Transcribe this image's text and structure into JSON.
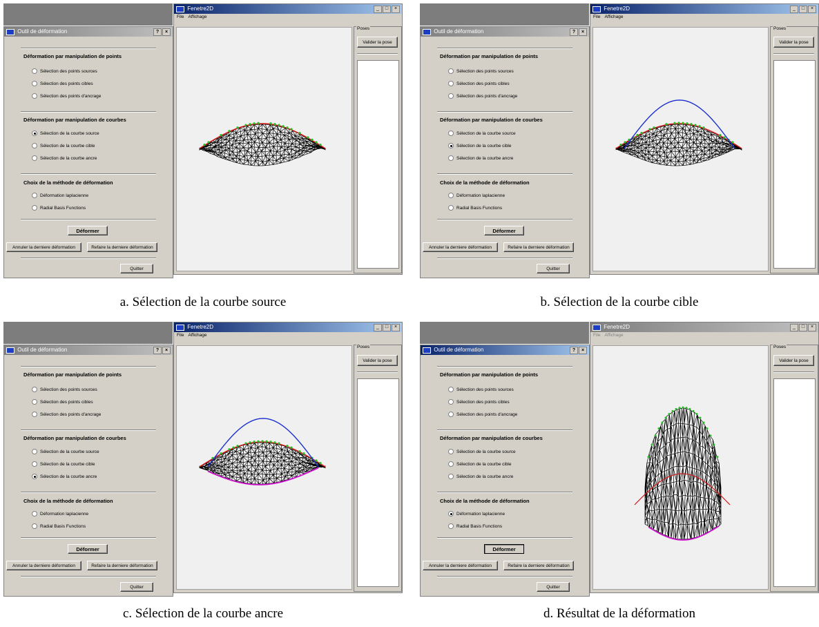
{
  "panels": [
    {
      "dialog": {
        "title": "Outil de déformation",
        "title_active": false,
        "help": "?",
        "close": "×",
        "section1": "Déformation par manipulation de points",
        "opt_points_sources": "Sélection des points sources",
        "opt_points_cibles": "Sélection des points cibles",
        "opt_points_ancrage": "Sélection des points d'ancrage",
        "section2": "Déformation par manipulation de courbes",
        "opt_courbe_source": "Sélection de la courbe source",
        "opt_courbe_cible": "Sélection de la courbe cible",
        "opt_courbe_ancre": "Sélection de la courbe ancre",
        "section3": "Choix de la méthode de déformation",
        "opt_laplacienne": "Déformation laplacienne",
        "opt_rbf": "Radial Basis Functions",
        "deformer": "Déformer",
        "annuler": "Annuler la derniere déformation",
        "refaire": "Refaire la derniere déformation",
        "quitter": "Quitter",
        "selected": "courbe_source"
      },
      "window": {
        "title": "Fenetre2D",
        "title_active": true,
        "menu_file": "File",
        "menu_affichage": "Affichage",
        "poses_label": "Poses",
        "valider": "Valider la pose"
      },
      "caption": "a. Sélection de la courbe source"
    },
    {
      "dialog": {
        "title": "Outil de déformation",
        "title_active": false,
        "help": "?",
        "close": "×",
        "section1": "Déformation par manipulation de points",
        "opt_points_sources": "Sélection des points sources",
        "opt_points_cibles": "Sélection des points cibles",
        "opt_points_ancrage": "Sélection des points d'ancrage",
        "section2": "Déformation par manipulation de courbes",
        "opt_courbe_source": "Sélection de la courbe source",
        "opt_courbe_cible": "Sélection de la courbe cible",
        "opt_courbe_ancre": "Sélection de la courbe ancre",
        "section3": "Choix de la méthode de déformation",
        "opt_laplacienne": "Déformation laplacienne",
        "opt_rbf": "Radial Basis Functions",
        "deformer": "Déformer",
        "annuler": "Annuler la derniere déformation",
        "refaire": "Refaire la derniere déformation",
        "quitter": "Quitter",
        "selected": "courbe_cible"
      },
      "window": {
        "title": "Fenetre2D",
        "title_active": true,
        "menu_file": "File",
        "menu_affichage": "Affichage",
        "poses_label": "Poses",
        "valider": "Valider la pose"
      },
      "caption": "b. Sélection de la courbe cible"
    },
    {
      "dialog": {
        "title": "Outil de déformation",
        "title_active": false,
        "help": "?",
        "close": "×",
        "section1": "Déformation par manipulation de points",
        "opt_points_sources": "Sélection des points sources",
        "opt_points_cibles": "Sélection des points cibles",
        "opt_points_ancrage": "Sélection des points d'ancrage",
        "section2": "Déformation par manipulation de courbes",
        "opt_courbe_source": "Sélection de la courbe source",
        "opt_courbe_cible": "Sélection de la courbe cible",
        "opt_courbe_ancre": "Sélection de la courbe ancre",
        "section3": "Choix de la méthode de déformation",
        "opt_laplacienne": "Déformation laplacienne",
        "opt_rbf": "Radial Basis Functions",
        "deformer": "Déformer",
        "annuler": "Annuler la derniere déformation",
        "refaire": "Refaire la derniere déformation",
        "quitter": "Quitter",
        "selected": "courbe_ancre"
      },
      "window": {
        "title": "Fenetre2D",
        "title_active": true,
        "menu_file": "File",
        "menu_affichage": "Affichage",
        "poses_label": "Poses",
        "valider": "Valider la pose"
      },
      "caption": "c. Sélection de la courbe ancre"
    },
    {
      "dialog": {
        "title": "Outil de déformation",
        "title_active": true,
        "help": "?",
        "close": "×",
        "section1": "Déformation par manipulation de points",
        "opt_points_sources": "Sélection des points sources",
        "opt_points_cibles": "Sélection des points cibles",
        "opt_points_ancrage": "Sélection des points d'ancrage",
        "section2": "Déformation par manipulation de courbes",
        "opt_courbe_source": "Sélection de la courbe source",
        "opt_courbe_cible": "Sélection de la courbe cible",
        "opt_courbe_ancre": "Sélection de la courbe ancre",
        "section3": "Choix de la méthode de déformation",
        "opt_laplacienne": "Déformation laplacienne",
        "opt_rbf": "Radial Basis Functions",
        "deformer": "Déformer",
        "annuler": "Annuler la derniere déformation",
        "refaire": "Refaire la derniere déformation",
        "quitter": "Quitter",
        "selected": "laplacienne"
      },
      "window": {
        "title": "Fenetre2D",
        "title_active": false,
        "menu_file": "File",
        "menu_affichage": "Affichage",
        "poses_label": "Poses",
        "valider": "Valider la pose"
      },
      "caption": "d. Résultat de la déformation"
    }
  ],
  "colors": {
    "source_curve": "#d01818",
    "anchor_points": "#22c022",
    "target_curve": "#1a2fd0",
    "anchor_curve": "#d010d0",
    "mesh": "#000000"
  }
}
